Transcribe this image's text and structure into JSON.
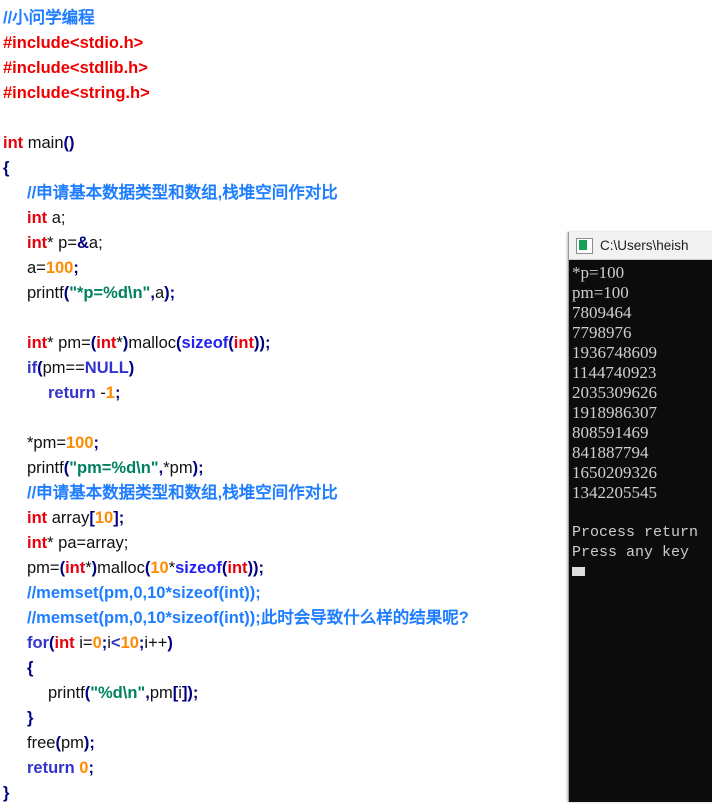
{
  "editor": {
    "name": "code-editor",
    "language": "C",
    "lines": [
      {
        "indent": 0,
        "tokens": [
          {
            "t": "//小问学编程",
            "c": "com"
          }
        ]
      },
      {
        "indent": 0,
        "tokens": [
          {
            "t": "#include<stdio.h>",
            "c": "pre"
          }
        ]
      },
      {
        "indent": 0,
        "tokens": [
          {
            "t": "#include<stdlib.h>",
            "c": "pre"
          }
        ]
      },
      {
        "indent": 0,
        "tokens": [
          {
            "t": "#include<string.h>",
            "c": "pre"
          }
        ]
      },
      {
        "indent": 0,
        "tokens": []
      },
      {
        "indent": 0,
        "tokens": [
          {
            "t": "int",
            "c": "type"
          },
          {
            "t": " main",
            "c": "plain"
          },
          {
            "t": "()",
            "c": "pun"
          }
        ]
      },
      {
        "indent": 0,
        "tokens": [
          {
            "t": "{",
            "c": "brace"
          }
        ]
      },
      {
        "indent": 1,
        "tokens": [
          {
            "t": "//申请基本数据类型和数组,栈堆空间作对比",
            "c": "com"
          }
        ]
      },
      {
        "indent": 1,
        "tokens": [
          {
            "t": "int",
            "c": "type"
          },
          {
            "t": " a;",
            "c": "plain"
          }
        ]
      },
      {
        "indent": 1,
        "tokens": [
          {
            "t": "int",
            "c": "type"
          },
          {
            "t": "* p=",
            "c": "plain"
          },
          {
            "t": "&",
            "c": "pun"
          },
          {
            "t": "a;",
            "c": "plain"
          }
        ]
      },
      {
        "indent": 1,
        "tokens": [
          {
            "t": "a=",
            "c": "plain"
          },
          {
            "t": "100",
            "c": "num"
          },
          {
            "t": ";",
            "c": "pun"
          }
        ]
      },
      {
        "indent": 1,
        "tokens": [
          {
            "t": "printf",
            "c": "plain"
          },
          {
            "t": "(",
            "c": "pun"
          },
          {
            "t": "\"*p=%d\\n\"",
            "c": "str"
          },
          {
            "t": ",",
            "c": "pun"
          },
          {
            "t": "a",
            "c": "plain"
          },
          {
            "t": ");",
            "c": "pun"
          }
        ]
      },
      {
        "indent": 0,
        "tokens": []
      },
      {
        "indent": 1,
        "tokens": [
          {
            "t": "int",
            "c": "type"
          },
          {
            "t": "* pm=",
            "c": "plain"
          },
          {
            "t": "(",
            "c": "pun"
          },
          {
            "t": "int",
            "c": "type"
          },
          {
            "t": "*",
            "c": "plain"
          },
          {
            "t": ")",
            "c": "pun"
          },
          {
            "t": "malloc",
            "c": "plain"
          },
          {
            "t": "(",
            "c": "pun"
          },
          {
            "t": "sizeof",
            "c": "kw2"
          },
          {
            "t": "(",
            "c": "pun"
          },
          {
            "t": "int",
            "c": "type"
          },
          {
            "t": "));",
            "c": "pun"
          }
        ]
      },
      {
        "indent": 1,
        "tokens": [
          {
            "t": "if",
            "c": "key"
          },
          {
            "t": "(",
            "c": "pun"
          },
          {
            "t": "pm==",
            "c": "plain"
          },
          {
            "t": "NULL",
            "c": "key"
          },
          {
            "t": ")",
            "c": "pun"
          }
        ]
      },
      {
        "indent": 2,
        "tokens": [
          {
            "t": "return",
            "c": "key"
          },
          {
            "t": " -",
            "c": "plain"
          },
          {
            "t": "1",
            "c": "num"
          },
          {
            "t": ";",
            "c": "pun"
          }
        ]
      },
      {
        "indent": 0,
        "tokens": []
      },
      {
        "indent": 1,
        "tokens": [
          {
            "t": "*pm=",
            "c": "plain"
          },
          {
            "t": "100",
            "c": "num"
          },
          {
            "t": ";",
            "c": "pun"
          }
        ]
      },
      {
        "indent": 1,
        "tokens": [
          {
            "t": "printf",
            "c": "plain"
          },
          {
            "t": "(",
            "c": "pun"
          },
          {
            "t": "\"pm=%d\\n\"",
            "c": "str"
          },
          {
            "t": ",",
            "c": "pun"
          },
          {
            "t": "*pm",
            "c": "plain"
          },
          {
            "t": ");",
            "c": "pun"
          }
        ]
      },
      {
        "indent": 1,
        "tokens": [
          {
            "t": "//申请基本数据类型和数组,栈堆空间作对比",
            "c": "com"
          }
        ]
      },
      {
        "indent": 1,
        "tokens": [
          {
            "t": "int",
            "c": "type"
          },
          {
            "t": " array",
            "c": "plain"
          },
          {
            "t": "[",
            "c": "pun"
          },
          {
            "t": "10",
            "c": "num"
          },
          {
            "t": "];",
            "c": "pun"
          }
        ]
      },
      {
        "indent": 1,
        "tokens": [
          {
            "t": "int",
            "c": "type"
          },
          {
            "t": "* pa=array;",
            "c": "plain"
          }
        ]
      },
      {
        "indent": 1,
        "tokens": [
          {
            "t": "pm=",
            "c": "plain"
          },
          {
            "t": "(",
            "c": "pun"
          },
          {
            "t": "int",
            "c": "type"
          },
          {
            "t": "*",
            "c": "plain"
          },
          {
            "t": ")",
            "c": "pun"
          },
          {
            "t": "malloc",
            "c": "plain"
          },
          {
            "t": "(",
            "c": "pun"
          },
          {
            "t": "10",
            "c": "num"
          },
          {
            "t": "*",
            "c": "plain"
          },
          {
            "t": "sizeof",
            "c": "kw2"
          },
          {
            "t": "(",
            "c": "pun"
          },
          {
            "t": "int",
            "c": "type"
          },
          {
            "t": "));",
            "c": "pun"
          }
        ]
      },
      {
        "indent": 1,
        "tokens": [
          {
            "t": "//memset(pm,0,10*sizeof(int));",
            "c": "com"
          }
        ]
      },
      {
        "indent": 1,
        "tokens": [
          {
            "t": "//memset(pm,0,10*sizeof(int));此时会导致什么样的结果呢?",
            "c": "com"
          }
        ]
      },
      {
        "indent": 1,
        "tokens": [
          {
            "t": "for",
            "c": "key"
          },
          {
            "t": "(",
            "c": "pun"
          },
          {
            "t": "int",
            "c": "type"
          },
          {
            "t": " i=",
            "c": "plain"
          },
          {
            "t": "0",
            "c": "num"
          },
          {
            "t": ";",
            "c": "pun"
          },
          {
            "t": "i",
            "c": "plain"
          },
          {
            "t": "<",
            "c": "key"
          },
          {
            "t": "10",
            "c": "num"
          },
          {
            "t": ";",
            "c": "pun"
          },
          {
            "t": "i++",
            "c": "plain"
          },
          {
            "t": ")",
            "c": "pun"
          }
        ]
      },
      {
        "indent": 1,
        "tokens": [
          {
            "t": "{",
            "c": "brace"
          }
        ]
      },
      {
        "indent": 2,
        "tokens": [
          {
            "t": "printf",
            "c": "plain"
          },
          {
            "t": "(",
            "c": "pun"
          },
          {
            "t": "\"%d\\n\"",
            "c": "str"
          },
          {
            "t": ",",
            "c": "pun"
          },
          {
            "t": "pm",
            "c": "plain"
          },
          {
            "t": "[",
            "c": "pun"
          },
          {
            "t": "i",
            "c": "plain"
          },
          {
            "t": "]);",
            "c": "pun"
          }
        ]
      },
      {
        "indent": 1,
        "tokens": [
          {
            "t": "}",
            "c": "brace"
          }
        ]
      },
      {
        "indent": 1,
        "tokens": [
          {
            "t": "free",
            "c": "plain"
          },
          {
            "t": "(",
            "c": "pun"
          },
          {
            "t": "pm",
            "c": "plain"
          },
          {
            "t": ");",
            "c": "pun"
          }
        ]
      },
      {
        "indent": 1,
        "tokens": [
          {
            "t": "return",
            "c": "key"
          },
          {
            "t": " ",
            "c": "plain"
          },
          {
            "t": "0",
            "c": "num"
          },
          {
            "t": ";",
            "c": "pun"
          }
        ]
      },
      {
        "indent": 0,
        "tokens": [
          {
            "t": "}",
            "c": "brace"
          }
        ]
      }
    ]
  },
  "console": {
    "title": "C:\\Users\\heish",
    "icon": "console-window-icon",
    "output": [
      {
        "text": "*p=100",
        "style": "serif"
      },
      {
        "text": "pm=100",
        "style": "serif"
      },
      {
        "text": "7809464",
        "style": "serif"
      },
      {
        "text": "7798976",
        "style": "serif"
      },
      {
        "text": "1936748609",
        "style": "serif"
      },
      {
        "text": "1144740923",
        "style": "serif"
      },
      {
        "text": "2035309626",
        "style": "serif"
      },
      {
        "text": "1918986307",
        "style": "serif"
      },
      {
        "text": "808591469",
        "style": "serif"
      },
      {
        "text": "841887794",
        "style": "serif"
      },
      {
        "text": "1650209326",
        "style": "serif"
      },
      {
        "text": "1342205545",
        "style": "serif"
      },
      {
        "text": "",
        "style": "blank"
      },
      {
        "text": "Process return",
        "style": "mono"
      },
      {
        "text": "Press any key",
        "style": "mono"
      }
    ],
    "cursor_visible": true
  },
  "colors": {
    "comment": "#1e7eff",
    "preprocessor": "#ee0000",
    "type": "#e8000d",
    "keyword": "#3333cc",
    "keyword_alt": "#2222ee",
    "string": "#008060",
    "number": "#ff8c00",
    "punctuation": "#000080",
    "editor_background": "#ffffff",
    "console_background": "#0c0c0c",
    "console_text": "#cfcfcf",
    "console_titlebar": "#f2f2f2"
  }
}
